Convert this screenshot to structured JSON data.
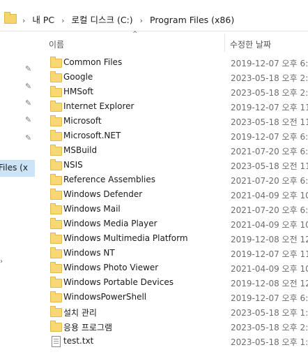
{
  "address_bar": {
    "crumbs": [
      "내 PC",
      "로컬 디스크 (C:)",
      "Program Files (x86)"
    ],
    "dropdown_icon": "chevron-down-icon"
  },
  "nav_pane": {
    "selected_label": "Files (x",
    "pin_icon": "pin-icon"
  },
  "columns": {
    "name": "이름",
    "date": "수정한 날짜"
  },
  "rows": [
    {
      "name": "Common Files",
      "date": "2019-12-07 오후 6:3",
      "type": "folder"
    },
    {
      "name": "Google",
      "date": "2023-05-18 오후 2:4",
      "type": "folder"
    },
    {
      "name": "HMSoft",
      "date": "2023-05-18 오후 2:3",
      "type": "folder"
    },
    {
      "name": "Internet Explorer",
      "date": "2019-12-07 오후 11",
      "type": "folder"
    },
    {
      "name": "Microsoft",
      "date": "2023-05-18 오전 11",
      "type": "folder"
    },
    {
      "name": "Microsoft.NET",
      "date": "2019-12-07 오후 6:3",
      "type": "folder"
    },
    {
      "name": "MSBuild",
      "date": "2021-07-20 오후 6:2",
      "type": "folder"
    },
    {
      "name": "NSIS",
      "date": "2023-05-18 오전 11",
      "type": "folder"
    },
    {
      "name": "Reference Assemblies",
      "date": "2021-07-20 오후 6:2",
      "type": "folder"
    },
    {
      "name": "Windows Defender",
      "date": "2021-04-09 오후 10",
      "type": "folder"
    },
    {
      "name": "Windows Mail",
      "date": "2021-07-20 오후 6:5",
      "type": "folder"
    },
    {
      "name": "Windows Media Player",
      "date": "2021-04-09 오후 10",
      "type": "folder"
    },
    {
      "name": "Windows Multimedia Platform",
      "date": "2019-12-08 오전 12",
      "type": "folder"
    },
    {
      "name": "Windows NT",
      "date": "2019-12-07 오후 11",
      "type": "folder"
    },
    {
      "name": "Windows Photo Viewer",
      "date": "2021-04-09 오후 10",
      "type": "folder"
    },
    {
      "name": "Windows Portable Devices",
      "date": "2019-12-08 오전 12",
      "type": "folder"
    },
    {
      "name": "WindowsPowerShell",
      "date": "2019-12-07 오후 6:3",
      "type": "folder"
    },
    {
      "name": "설치 관리",
      "date": "2023-05-18 오후 1:3",
      "type": "folder"
    },
    {
      "name": "응용 프로그램",
      "date": "2023-05-18 오후 2:2",
      "type": "folder"
    },
    {
      "name": "test.txt",
      "date": "2023-05-18 오후 1:3",
      "type": "file"
    }
  ]
}
